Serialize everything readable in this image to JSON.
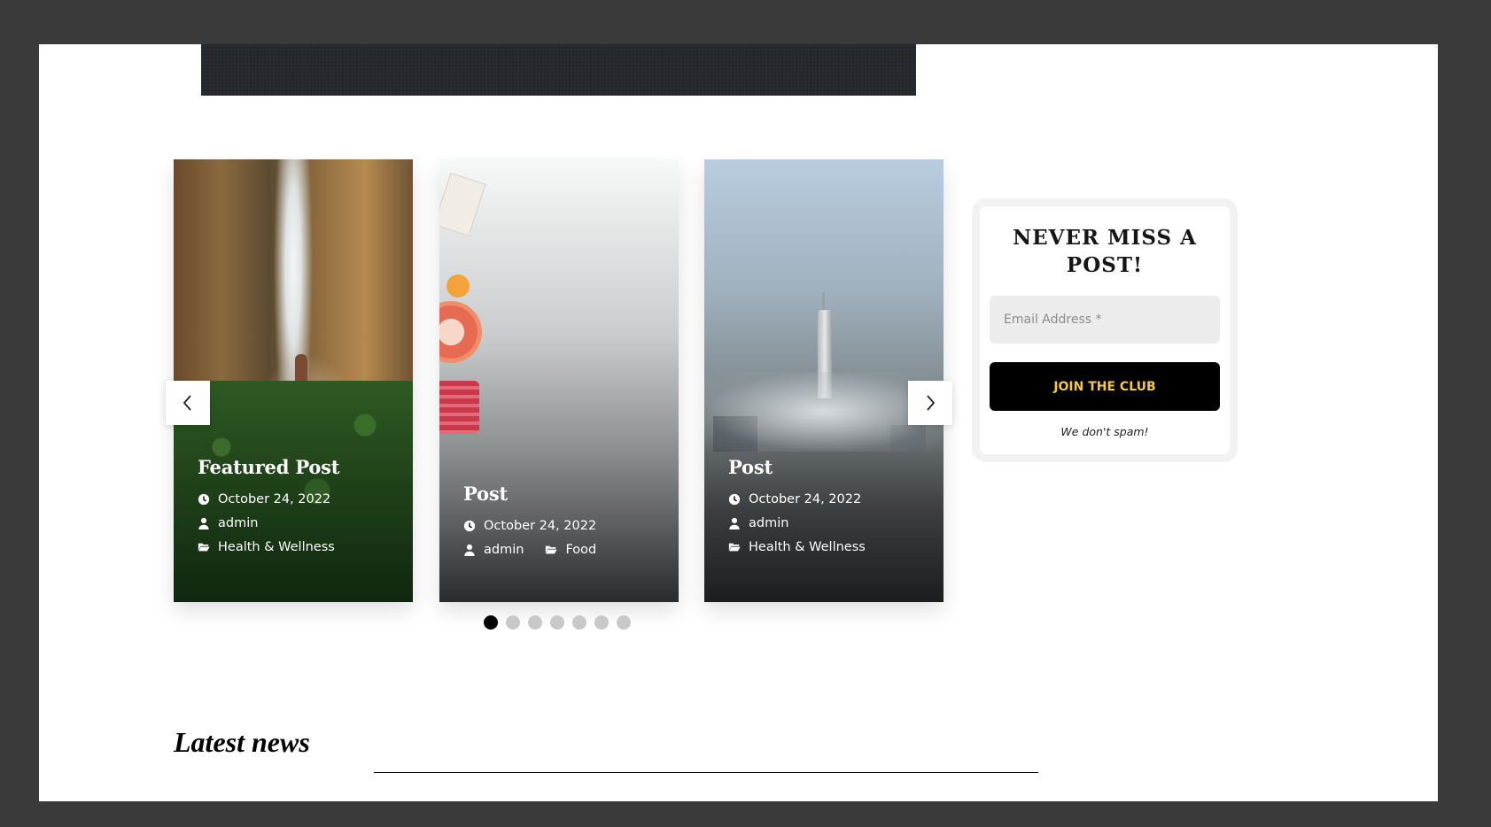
{
  "slider": {
    "cards": [
      {
        "title": "Featured Post",
        "date": "October 24, 2022",
        "author": "admin",
        "category": "Health & Wellness"
      },
      {
        "title": "Post",
        "date": "October 24, 2022",
        "author": "admin",
        "category": "Food"
      },
      {
        "title": "Post",
        "date": "October 24, 2022",
        "author": "admin",
        "category": "Health & Wellness"
      }
    ],
    "prev_icon": "chevron-left-icon",
    "next_icon": "chevron-right-icon",
    "dots_count": 7,
    "active_dot": 1
  },
  "newsletter": {
    "title": "NEVER MISS A POST!",
    "email_placeholder": "Email Address *",
    "button_label": "JOIN THE CLUB",
    "note": "We don't spam!",
    "button_text_color": "#f2c94c"
  },
  "latest": {
    "title": "Latest news"
  }
}
